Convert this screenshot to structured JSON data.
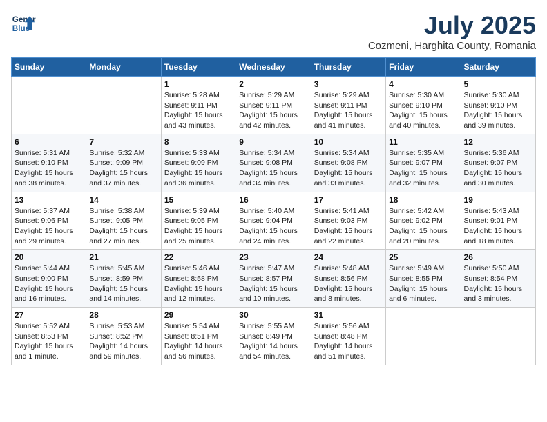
{
  "logo": {
    "line1": "General",
    "line2": "Blue"
  },
  "title": "July 2025",
  "subtitle": "Cozmeni, Harghita County, Romania",
  "weekdays": [
    "Sunday",
    "Monday",
    "Tuesday",
    "Wednesday",
    "Thursday",
    "Friday",
    "Saturday"
  ],
  "weeks": [
    [
      {
        "day": "",
        "info": ""
      },
      {
        "day": "",
        "info": ""
      },
      {
        "day": "1",
        "info": "Sunrise: 5:28 AM\nSunset: 9:11 PM\nDaylight: 15 hours\nand 43 minutes."
      },
      {
        "day": "2",
        "info": "Sunrise: 5:29 AM\nSunset: 9:11 PM\nDaylight: 15 hours\nand 42 minutes."
      },
      {
        "day": "3",
        "info": "Sunrise: 5:29 AM\nSunset: 9:11 PM\nDaylight: 15 hours\nand 41 minutes."
      },
      {
        "day": "4",
        "info": "Sunrise: 5:30 AM\nSunset: 9:10 PM\nDaylight: 15 hours\nand 40 minutes."
      },
      {
        "day": "5",
        "info": "Sunrise: 5:30 AM\nSunset: 9:10 PM\nDaylight: 15 hours\nand 39 minutes."
      }
    ],
    [
      {
        "day": "6",
        "info": "Sunrise: 5:31 AM\nSunset: 9:10 PM\nDaylight: 15 hours\nand 38 minutes."
      },
      {
        "day": "7",
        "info": "Sunrise: 5:32 AM\nSunset: 9:09 PM\nDaylight: 15 hours\nand 37 minutes."
      },
      {
        "day": "8",
        "info": "Sunrise: 5:33 AM\nSunset: 9:09 PM\nDaylight: 15 hours\nand 36 minutes."
      },
      {
        "day": "9",
        "info": "Sunrise: 5:34 AM\nSunset: 9:08 PM\nDaylight: 15 hours\nand 34 minutes."
      },
      {
        "day": "10",
        "info": "Sunrise: 5:34 AM\nSunset: 9:08 PM\nDaylight: 15 hours\nand 33 minutes."
      },
      {
        "day": "11",
        "info": "Sunrise: 5:35 AM\nSunset: 9:07 PM\nDaylight: 15 hours\nand 32 minutes."
      },
      {
        "day": "12",
        "info": "Sunrise: 5:36 AM\nSunset: 9:07 PM\nDaylight: 15 hours\nand 30 minutes."
      }
    ],
    [
      {
        "day": "13",
        "info": "Sunrise: 5:37 AM\nSunset: 9:06 PM\nDaylight: 15 hours\nand 29 minutes."
      },
      {
        "day": "14",
        "info": "Sunrise: 5:38 AM\nSunset: 9:05 PM\nDaylight: 15 hours\nand 27 minutes."
      },
      {
        "day": "15",
        "info": "Sunrise: 5:39 AM\nSunset: 9:05 PM\nDaylight: 15 hours\nand 25 minutes."
      },
      {
        "day": "16",
        "info": "Sunrise: 5:40 AM\nSunset: 9:04 PM\nDaylight: 15 hours\nand 24 minutes."
      },
      {
        "day": "17",
        "info": "Sunrise: 5:41 AM\nSunset: 9:03 PM\nDaylight: 15 hours\nand 22 minutes."
      },
      {
        "day": "18",
        "info": "Sunrise: 5:42 AM\nSunset: 9:02 PM\nDaylight: 15 hours\nand 20 minutes."
      },
      {
        "day": "19",
        "info": "Sunrise: 5:43 AM\nSunset: 9:01 PM\nDaylight: 15 hours\nand 18 minutes."
      }
    ],
    [
      {
        "day": "20",
        "info": "Sunrise: 5:44 AM\nSunset: 9:00 PM\nDaylight: 15 hours\nand 16 minutes."
      },
      {
        "day": "21",
        "info": "Sunrise: 5:45 AM\nSunset: 8:59 PM\nDaylight: 15 hours\nand 14 minutes."
      },
      {
        "day": "22",
        "info": "Sunrise: 5:46 AM\nSunset: 8:58 PM\nDaylight: 15 hours\nand 12 minutes."
      },
      {
        "day": "23",
        "info": "Sunrise: 5:47 AM\nSunset: 8:57 PM\nDaylight: 15 hours\nand 10 minutes."
      },
      {
        "day": "24",
        "info": "Sunrise: 5:48 AM\nSunset: 8:56 PM\nDaylight: 15 hours\nand 8 minutes."
      },
      {
        "day": "25",
        "info": "Sunrise: 5:49 AM\nSunset: 8:55 PM\nDaylight: 15 hours\nand 6 minutes."
      },
      {
        "day": "26",
        "info": "Sunrise: 5:50 AM\nSunset: 8:54 PM\nDaylight: 15 hours\nand 3 minutes."
      }
    ],
    [
      {
        "day": "27",
        "info": "Sunrise: 5:52 AM\nSunset: 8:53 PM\nDaylight: 15 hours\nand 1 minute."
      },
      {
        "day": "28",
        "info": "Sunrise: 5:53 AM\nSunset: 8:52 PM\nDaylight: 14 hours\nand 59 minutes."
      },
      {
        "day": "29",
        "info": "Sunrise: 5:54 AM\nSunset: 8:51 PM\nDaylight: 14 hours\nand 56 minutes."
      },
      {
        "day": "30",
        "info": "Sunrise: 5:55 AM\nSunset: 8:49 PM\nDaylight: 14 hours\nand 54 minutes."
      },
      {
        "day": "31",
        "info": "Sunrise: 5:56 AM\nSunset: 8:48 PM\nDaylight: 14 hours\nand 51 minutes."
      },
      {
        "day": "",
        "info": ""
      },
      {
        "day": "",
        "info": ""
      }
    ]
  ]
}
